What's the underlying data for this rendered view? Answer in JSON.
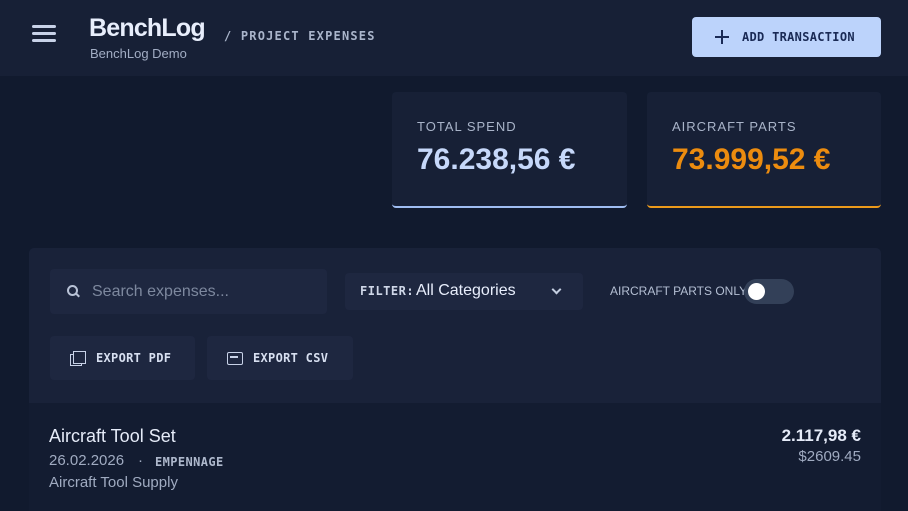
{
  "app": {
    "title": "BenchLog",
    "subtitle": "BenchLog Demo",
    "breadcrumb": "/ PROJECT EXPENSES",
    "add_button_label": "ADD TRANSACTION"
  },
  "icons": {
    "menu": "hamburger-menu-icon",
    "add": "plus-icon",
    "search": "search-icon",
    "filter": "chevron-down-icon",
    "export_pdf": "pdf-file-icon",
    "export_csv": "csv-file-icon"
  },
  "summary": {
    "total_spend": {
      "label": "TOTAL SPEND",
      "value": "76.238,56 €",
      "accent": "#9fbdf2"
    },
    "aircraft_parts": {
      "label": "AIRCRAFT PARTS",
      "value": "73.999,52 €",
      "accent": "#ec8c0f"
    }
  },
  "controls": {
    "search_placeholder": "Search expenses...",
    "search_value": "",
    "filter_label": "FILTER:",
    "filter_value": "All Categories",
    "toggle_label": "AIRCRAFT PARTS ONLY",
    "toggle_on": false,
    "export_pdf_label": "EXPORT PDF",
    "export_csv_label": "EXPORT CSV"
  },
  "transactions": [
    {
      "name": "Aircraft Tool Set",
      "date": "26.02.2026",
      "separator": "·",
      "category": "EMPENNAGE",
      "vendor": "Aircraft Tool Supply",
      "amount": "2.117,98 €",
      "original_amount": "$2609.45"
    }
  ]
}
